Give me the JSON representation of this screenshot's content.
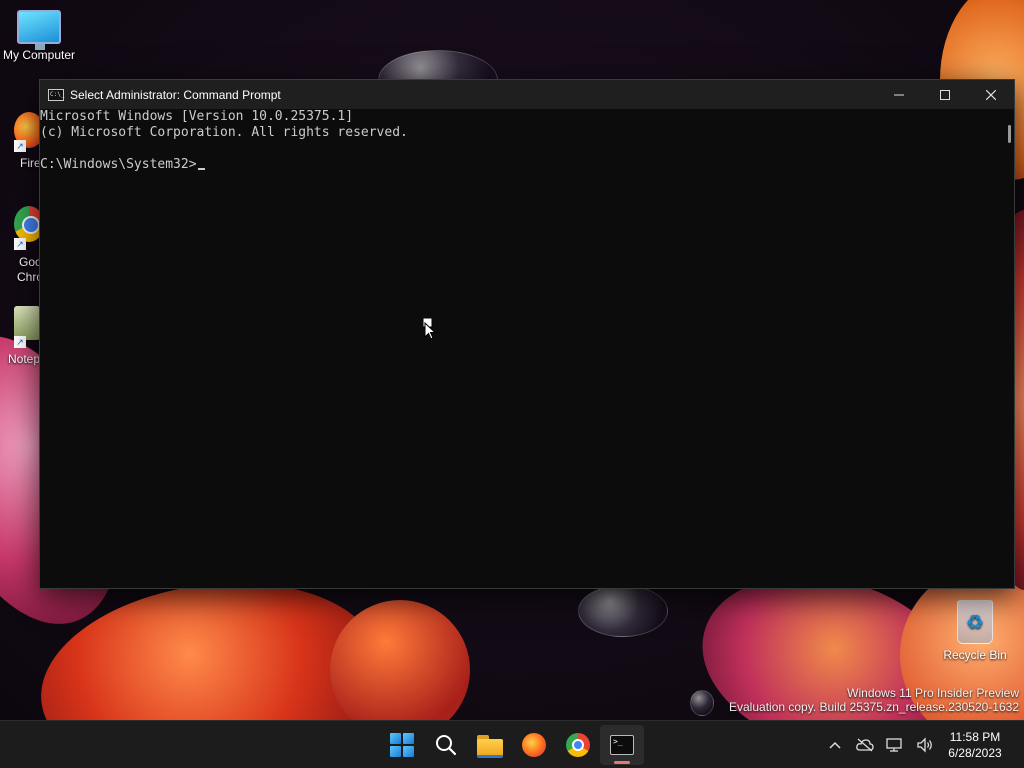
{
  "desktop": {
    "icons": {
      "my_computer": "My Computer",
      "firefox": "Fire",
      "chrome_line1": "Goo",
      "chrome_line2": "Chro",
      "notepad": "Notep",
      "recycle_bin": "Recycle Bin"
    },
    "watermark": {
      "line1": "Windows 11 Pro Insider Preview",
      "line2": "Evaluation copy. Build 25375.zn_release.230520-1632"
    }
  },
  "window": {
    "title": "Select Administrator:  Command Prompt",
    "icon_text": "C:\\_",
    "console_lines": [
      "Microsoft Windows [Version 10.0.25375.1]",
      "(c) Microsoft Corporation. All rights reserved.",
      "",
      "C:\\Windows\\System32>"
    ]
  },
  "taskbar": {
    "icons": [
      "start-icon",
      "search-icon",
      "file-explorer-icon",
      "firefox-icon",
      "chrome-icon",
      "terminal-icon"
    ],
    "active": "terminal-icon",
    "tray": {
      "time": "11:58 PM",
      "date": "6/28/2023"
    },
    "terminal_icon_text": ">_"
  },
  "colors": {
    "console_bg": "#0c0c0c",
    "console_text": "#cccccc",
    "titlebar_bg": "#1f1f1f",
    "taskbar_bg": "#1c1c1c",
    "active_indicator": "#e07a7a"
  }
}
